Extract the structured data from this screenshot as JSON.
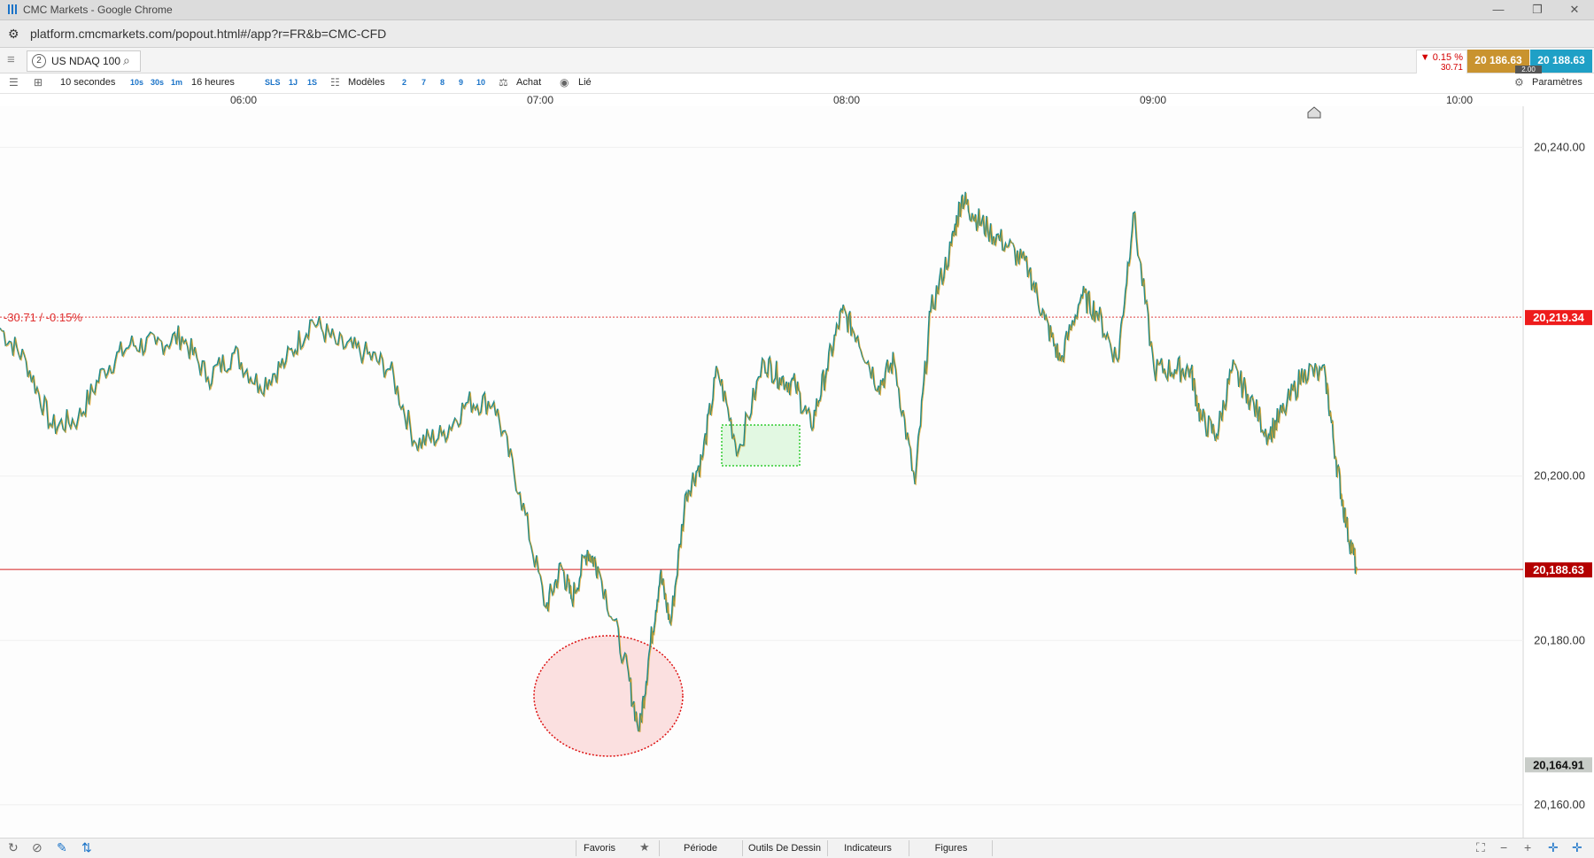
{
  "window": {
    "title": "CMC Markets - Google Chrome",
    "url": "platform.cmcmarkets.com/popout.html#/app?r=FR&b=CMC-CFD"
  },
  "instrument": {
    "number": "2",
    "name": "US NDAQ 100",
    "change_pct": "▼ 0.15 %",
    "change_abs": "30.71",
    "sell_price": "20 186.63",
    "buy_price": "20 188.63",
    "spread": "2.00"
  },
  "toolbar": {
    "interval": "10 secondes",
    "intervals": [
      "10s",
      "30s",
      "1m"
    ],
    "range": "16 heures",
    "extra_buttons": [
      "SLS",
      "1J",
      "1S"
    ],
    "models_label": "Modèles",
    "quick_periods": [
      "2",
      "7",
      "8",
      "9",
      "10"
    ],
    "buy_label": "Achat",
    "link_label": "Lié",
    "settings_label": "Paramètres"
  },
  "time_axis": [
    "06:00",
    "07:00",
    "08:00",
    "09:00",
    "10:00"
  ],
  "bottom_tabs": {
    "favorites": "Favoris",
    "period": "Période",
    "drawing_tools": "Outils De Dessin",
    "indicators": "Indicateurs",
    "figures": "Figures"
  },
  "icons": {
    "refresh": "refresh-icon",
    "block": "block-icon",
    "pencil": "pencil-icon",
    "arrows": "arrows-icon",
    "star": "star-icon",
    "settings": "gear-icon",
    "search": "search-icon"
  },
  "chart_data": {
    "type": "line",
    "y_ticks": [
      20240.0,
      20200.0,
      20180.0,
      20160.0
    ],
    "y_tick_labels": [
      "20,240.00",
      "20,200.00",
      "20,180.00",
      "20,160.00"
    ],
    "ylim": [
      20156.0,
      20245.0
    ],
    "x_ticks": [
      "06:00",
      "07:00",
      "08:00",
      "09:00",
      "10:00"
    ],
    "x_range": [
      "05:13",
      "10:06"
    ],
    "prev_close": 20219.34,
    "prev_close_label": "20,219.34",
    "prev_close_annotation": "-30.71 / -0.15%",
    "current_price": 20188.63,
    "current_price_label": "20,188.63",
    "low_marker": 20164.91,
    "low_marker_label": "20,164.91",
    "series": [
      {
        "x": [
          "05:13",
          "05:18",
          "05:23",
          "05:28",
          "05:33",
          "05:38",
          "05:43",
          "05:48",
          "05:53",
          "05:58",
          "06:03",
          "06:08",
          "06:13",
          "06:18",
          "06:23",
          "06:28",
          "06:33",
          "06:38",
          "06:43",
          "06:48",
          "06:53",
          "06:58",
          "07:01",
          "07:03",
          "07:06",
          "07:08",
          "07:13",
          "07:16",
          "07:18",
          "07:20",
          "07:22",
          "07:25",
          "07:28",
          "07:31",
          "07:35",
          "07:40",
          "07:43",
          "07:46",
          "07:49",
          "07:52",
          "07:55",
          "07:58",
          "08:02",
          "08:05",
          "08:09",
          "08:12",
          "08:16",
          "08:18",
          "08:20",
          "08:23",
          "08:27",
          "08:31",
          "08:34",
          "08:37",
          "08:41",
          "08:44",
          "08:48",
          "08:51",
          "08:55",
          "08:59",
          "09:02",
          "09:04",
          "09:07",
          "09:10",
          "09:13",
          "09:17",
          "09:20",
          "09:24",
          "09:28",
          "09:30",
          "09:32",
          "09:34"
        ],
        "values": [
          20218,
          20214,
          20206,
          20207,
          20213,
          20216,
          20216,
          20217,
          20212,
          20215,
          20211,
          20214,
          20219,
          20216,
          20215,
          20213,
          20204,
          20205,
          20209,
          20209,
          20198,
          20184,
          20189,
          20185,
          20191,
          20189,
          20178,
          20169,
          20179,
          20188,
          20182,
          20198,
          20202,
          20213,
          20203,
          20214,
          20212,
          20211,
          20206,
          20213,
          20220,
          20217,
          20211,
          20214,
          20199,
          20220,
          20228,
          20234,
          20232,
          20230,
          20228,
          20225,
          20219,
          20214,
          20222,
          20220,
          20214,
          20232,
          20213,
          20213,
          20213,
          20207,
          20205,
          20213,
          20210,
          20205,
          20208,
          20213,
          20212,
          20202,
          20194,
          20188.63
        ]
      }
    ]
  }
}
